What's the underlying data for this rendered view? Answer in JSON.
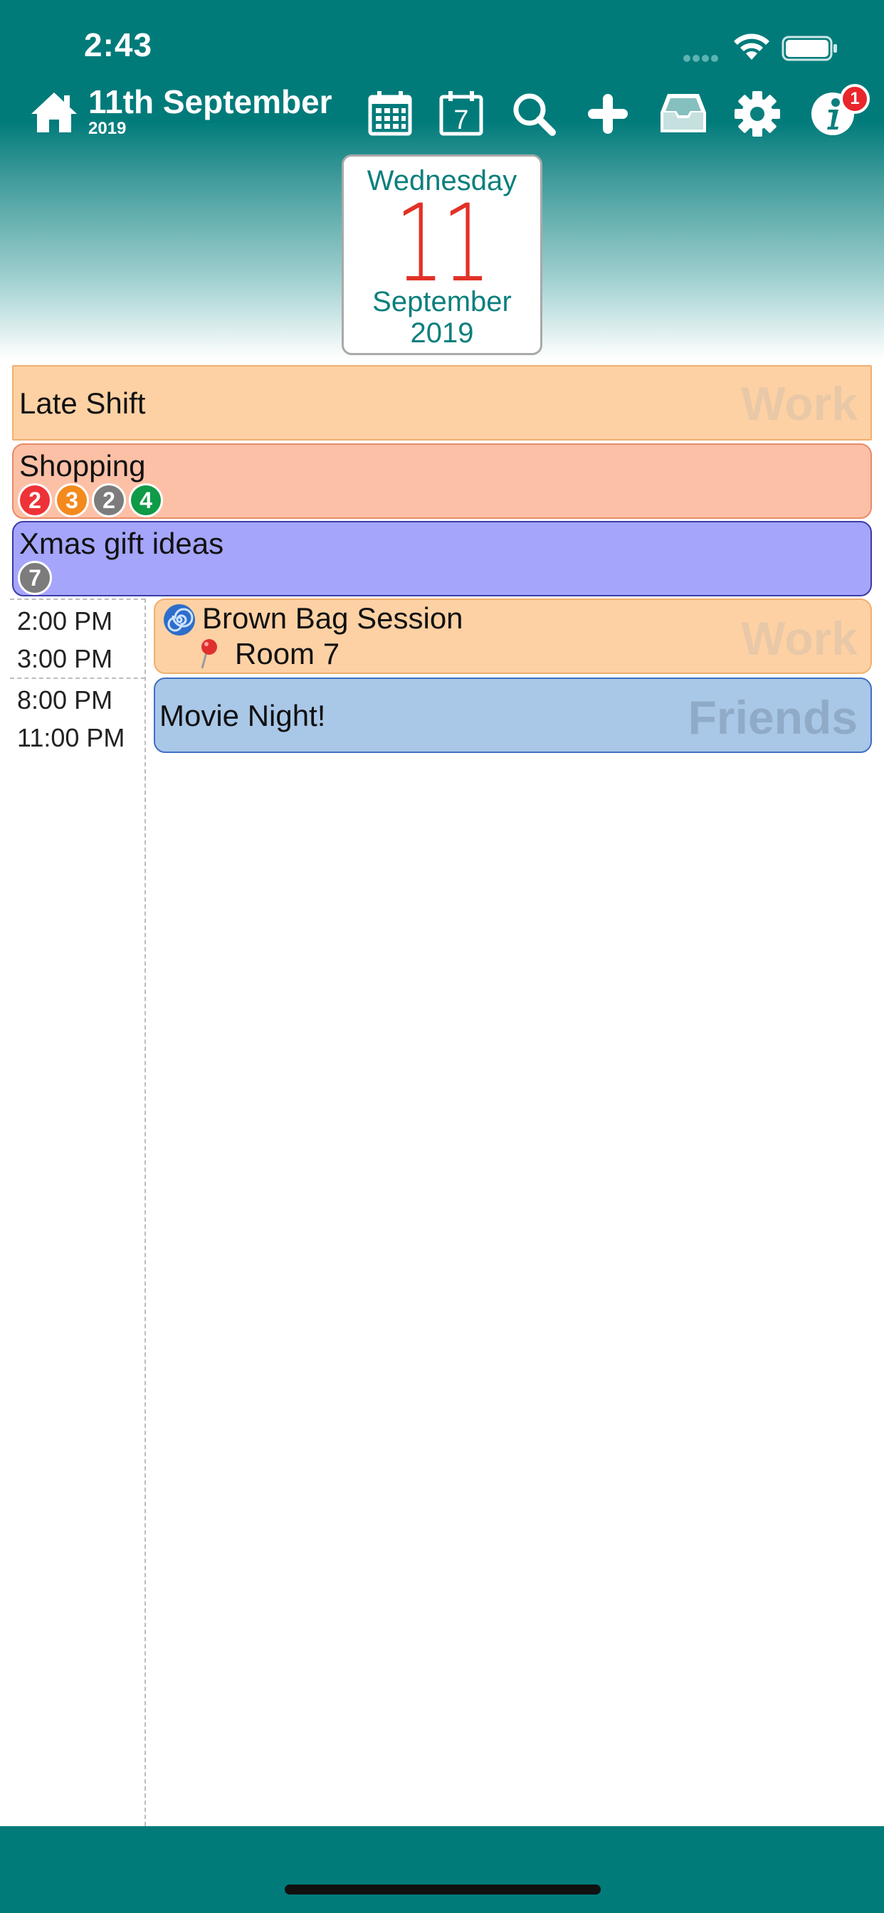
{
  "status_bar": {
    "time": "2:43"
  },
  "nav": {
    "title": "11th September",
    "subtitle": "2019",
    "info_badge_count": "1",
    "icons": [
      "home-icon",
      "calendar-month-icon",
      "calendar-day-icon",
      "search-icon",
      "plus-icon",
      "inbox-icon",
      "gear-icon",
      "info-icon"
    ]
  },
  "date_card": {
    "weekday": "Wednesday",
    "day": "11",
    "month": "September",
    "year": "2019"
  },
  "all_day_events": [
    {
      "title": "Late Shift",
      "calendar": "Work",
      "color": "#fdd1a4"
    },
    {
      "title": "Shopping",
      "badges": [
        {
          "value": "2",
          "color": "#ee3237"
        },
        {
          "value": "3",
          "color": "#f38a1e"
        },
        {
          "value": "2",
          "color": "#7c7c7c"
        },
        {
          "value": "4",
          "color": "#0e9a47"
        }
      ],
      "color": "#fcc0a6"
    },
    {
      "title": "Xmas gift ideas",
      "badges": [
        {
          "value": "7",
          "color": "#7c7c7c"
        }
      ],
      "color": "#a5a5fb"
    }
  ],
  "timed_events": [
    {
      "start": "2:00 PM",
      "end": "3:00 PM",
      "title": "Brown Bag Session",
      "location": "Room 7",
      "calendar": "Work",
      "color": "#fdd1a4"
    },
    {
      "start": "8:00 PM",
      "end": "11:00 PM",
      "title": "Movie Night!",
      "calendar": "Friends",
      "color": "#a9c7e7"
    }
  ],
  "colors": {
    "brand_teal": "#007b7a",
    "day_red": "#e23127"
  }
}
